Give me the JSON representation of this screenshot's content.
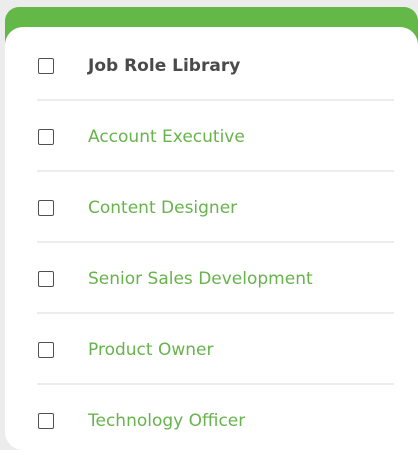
{
  "table": {
    "header": {
      "label": "Job Role Library",
      "checked": false
    },
    "rows": [
      {
        "label": "Account Executive",
        "checked": false
      },
      {
        "label": "Content Designer",
        "checked": false
      },
      {
        "label": "Senior Sales Development",
        "checked": false
      },
      {
        "label": "Product Owner",
        "checked": false
      },
      {
        "label": "Technology Officer",
        "checked": false
      }
    ]
  },
  "colors": {
    "accent": "#63b848",
    "link_text": "#67b34c",
    "header_text": "#4a4a4a",
    "background": "#ececec",
    "card": "#ffffff"
  }
}
